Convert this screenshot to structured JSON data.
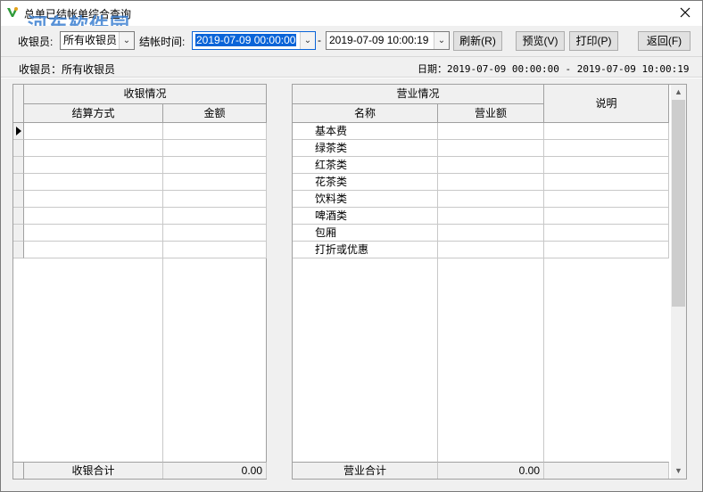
{
  "window": {
    "title": "总单已结帐单综合查询"
  },
  "watermark": {
    "text": "河东软件园",
    "url": "www.pc0359.cn"
  },
  "toolbar": {
    "cashier_label": "收银员:",
    "cashier_value": "所有收银员",
    "time_label": "结帐时间:",
    "start_time": "2019-07-09 00:00:00",
    "separator": "-",
    "end_time": "2019-07-09 10:00:19",
    "refresh_label": "刷新(R)",
    "preview_label": "预览(V)",
    "print_label": "打印(P)",
    "back_label": "返回(F)"
  },
  "info": {
    "cashier_text": "收银员：所有收银员",
    "date_text": "日期：2019-07-09 00:00:00 - 2019-07-09 10:00:19"
  },
  "cashier_grid": {
    "group_header": "收银情况",
    "columns": [
      "结算方式",
      "金额"
    ],
    "rows": [
      [
        "",
        ""
      ],
      [
        "",
        ""
      ],
      [
        "",
        ""
      ],
      [
        "",
        ""
      ],
      [
        "",
        ""
      ],
      [
        "",
        ""
      ],
      [
        "",
        ""
      ],
      [
        "",
        ""
      ]
    ],
    "footer_label": "收银合计",
    "footer_total": "0.00"
  },
  "business_grid": {
    "group_header": "营业情况",
    "columns": [
      "名称",
      "营业额"
    ],
    "note_header": "说明",
    "rows": [
      {
        "name": "基本费",
        "amount": "",
        "note": ""
      },
      {
        "name": "绿茶类",
        "amount": "",
        "note": ""
      },
      {
        "name": "红茶类",
        "amount": "",
        "note": ""
      },
      {
        "name": "花茶类",
        "amount": "",
        "note": ""
      },
      {
        "name": "饮料类",
        "amount": "",
        "note": ""
      },
      {
        "name": "啤酒类",
        "amount": "",
        "note": ""
      },
      {
        "name": "包厢",
        "amount": "",
        "note": ""
      },
      {
        "name": "打折或优惠",
        "amount": "",
        "note": ""
      }
    ],
    "footer_label": "营业合计",
    "footer_total": "0.00"
  },
  "icons": {
    "app": "app-logo-icon",
    "close": "close-icon",
    "dropdown": "chevron-down-icon",
    "row_pointer": "row-pointer-icon"
  },
  "colors": {
    "selection": "#0a64d8",
    "watermark": "#3b7fd1"
  }
}
